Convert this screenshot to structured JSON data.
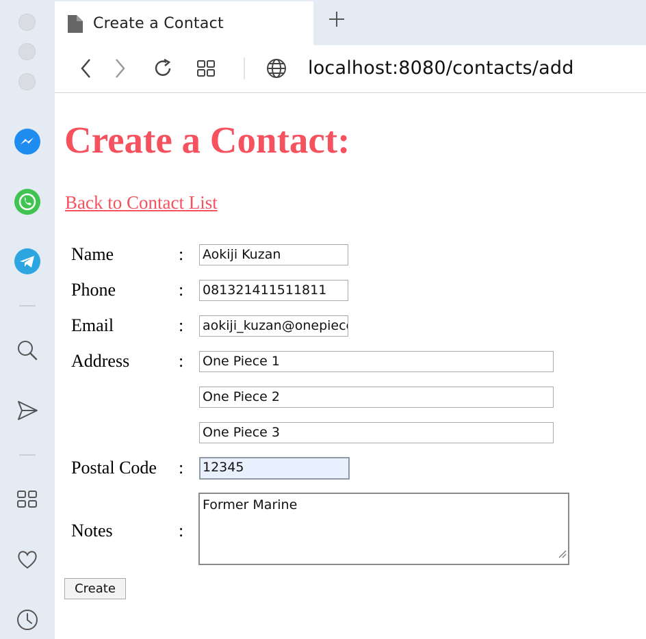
{
  "browser": {
    "tab_title": "Create a Contact",
    "url": "localhost:8080/contacts/add"
  },
  "sidebar": {
    "apps": [
      {
        "icon": "messenger-icon",
        "color": "#1f8cf0"
      },
      {
        "icon": "whatsapp-icon",
        "color": "#40c351"
      },
      {
        "icon": "telegram-icon",
        "color": "#2ca5e0"
      }
    ],
    "tools": [
      "search-icon",
      "send-icon",
      "grid-icon",
      "heart-icon",
      "clock-icon"
    ]
  },
  "page": {
    "title": "Create a Contact:",
    "back_link": "Back to Contact List",
    "accent_color": "#f5515f",
    "form": {
      "colon": ":",
      "name_label": "Name",
      "name_value": "Aokiji Kuzan",
      "phone_label": "Phone",
      "phone_value": "081321411511811",
      "email_label": "Email",
      "email_value": "aokiji_kuzan@onepiece",
      "address_label": "Address",
      "address_1": "One Piece 1",
      "address_2": "One Piece 2",
      "address_3": "One Piece 3",
      "postal_label": "Postal Code",
      "postal_value": "12345",
      "notes_label": "Notes",
      "notes_value": "Former Marine",
      "submit_label": "Create"
    }
  }
}
